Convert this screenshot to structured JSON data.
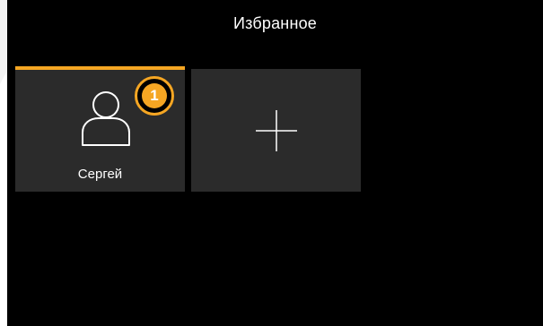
{
  "header": {
    "title": "Избранное"
  },
  "favorites": [
    {
      "name": "Сергей",
      "icon": "user-icon",
      "badge_count": "1"
    }
  ],
  "add_tile": {
    "icon": "plus-icon"
  },
  "colors": {
    "background": "#000000",
    "tile": "#2b2b2b",
    "accent": "#f5a623",
    "text": "#ffffff"
  }
}
